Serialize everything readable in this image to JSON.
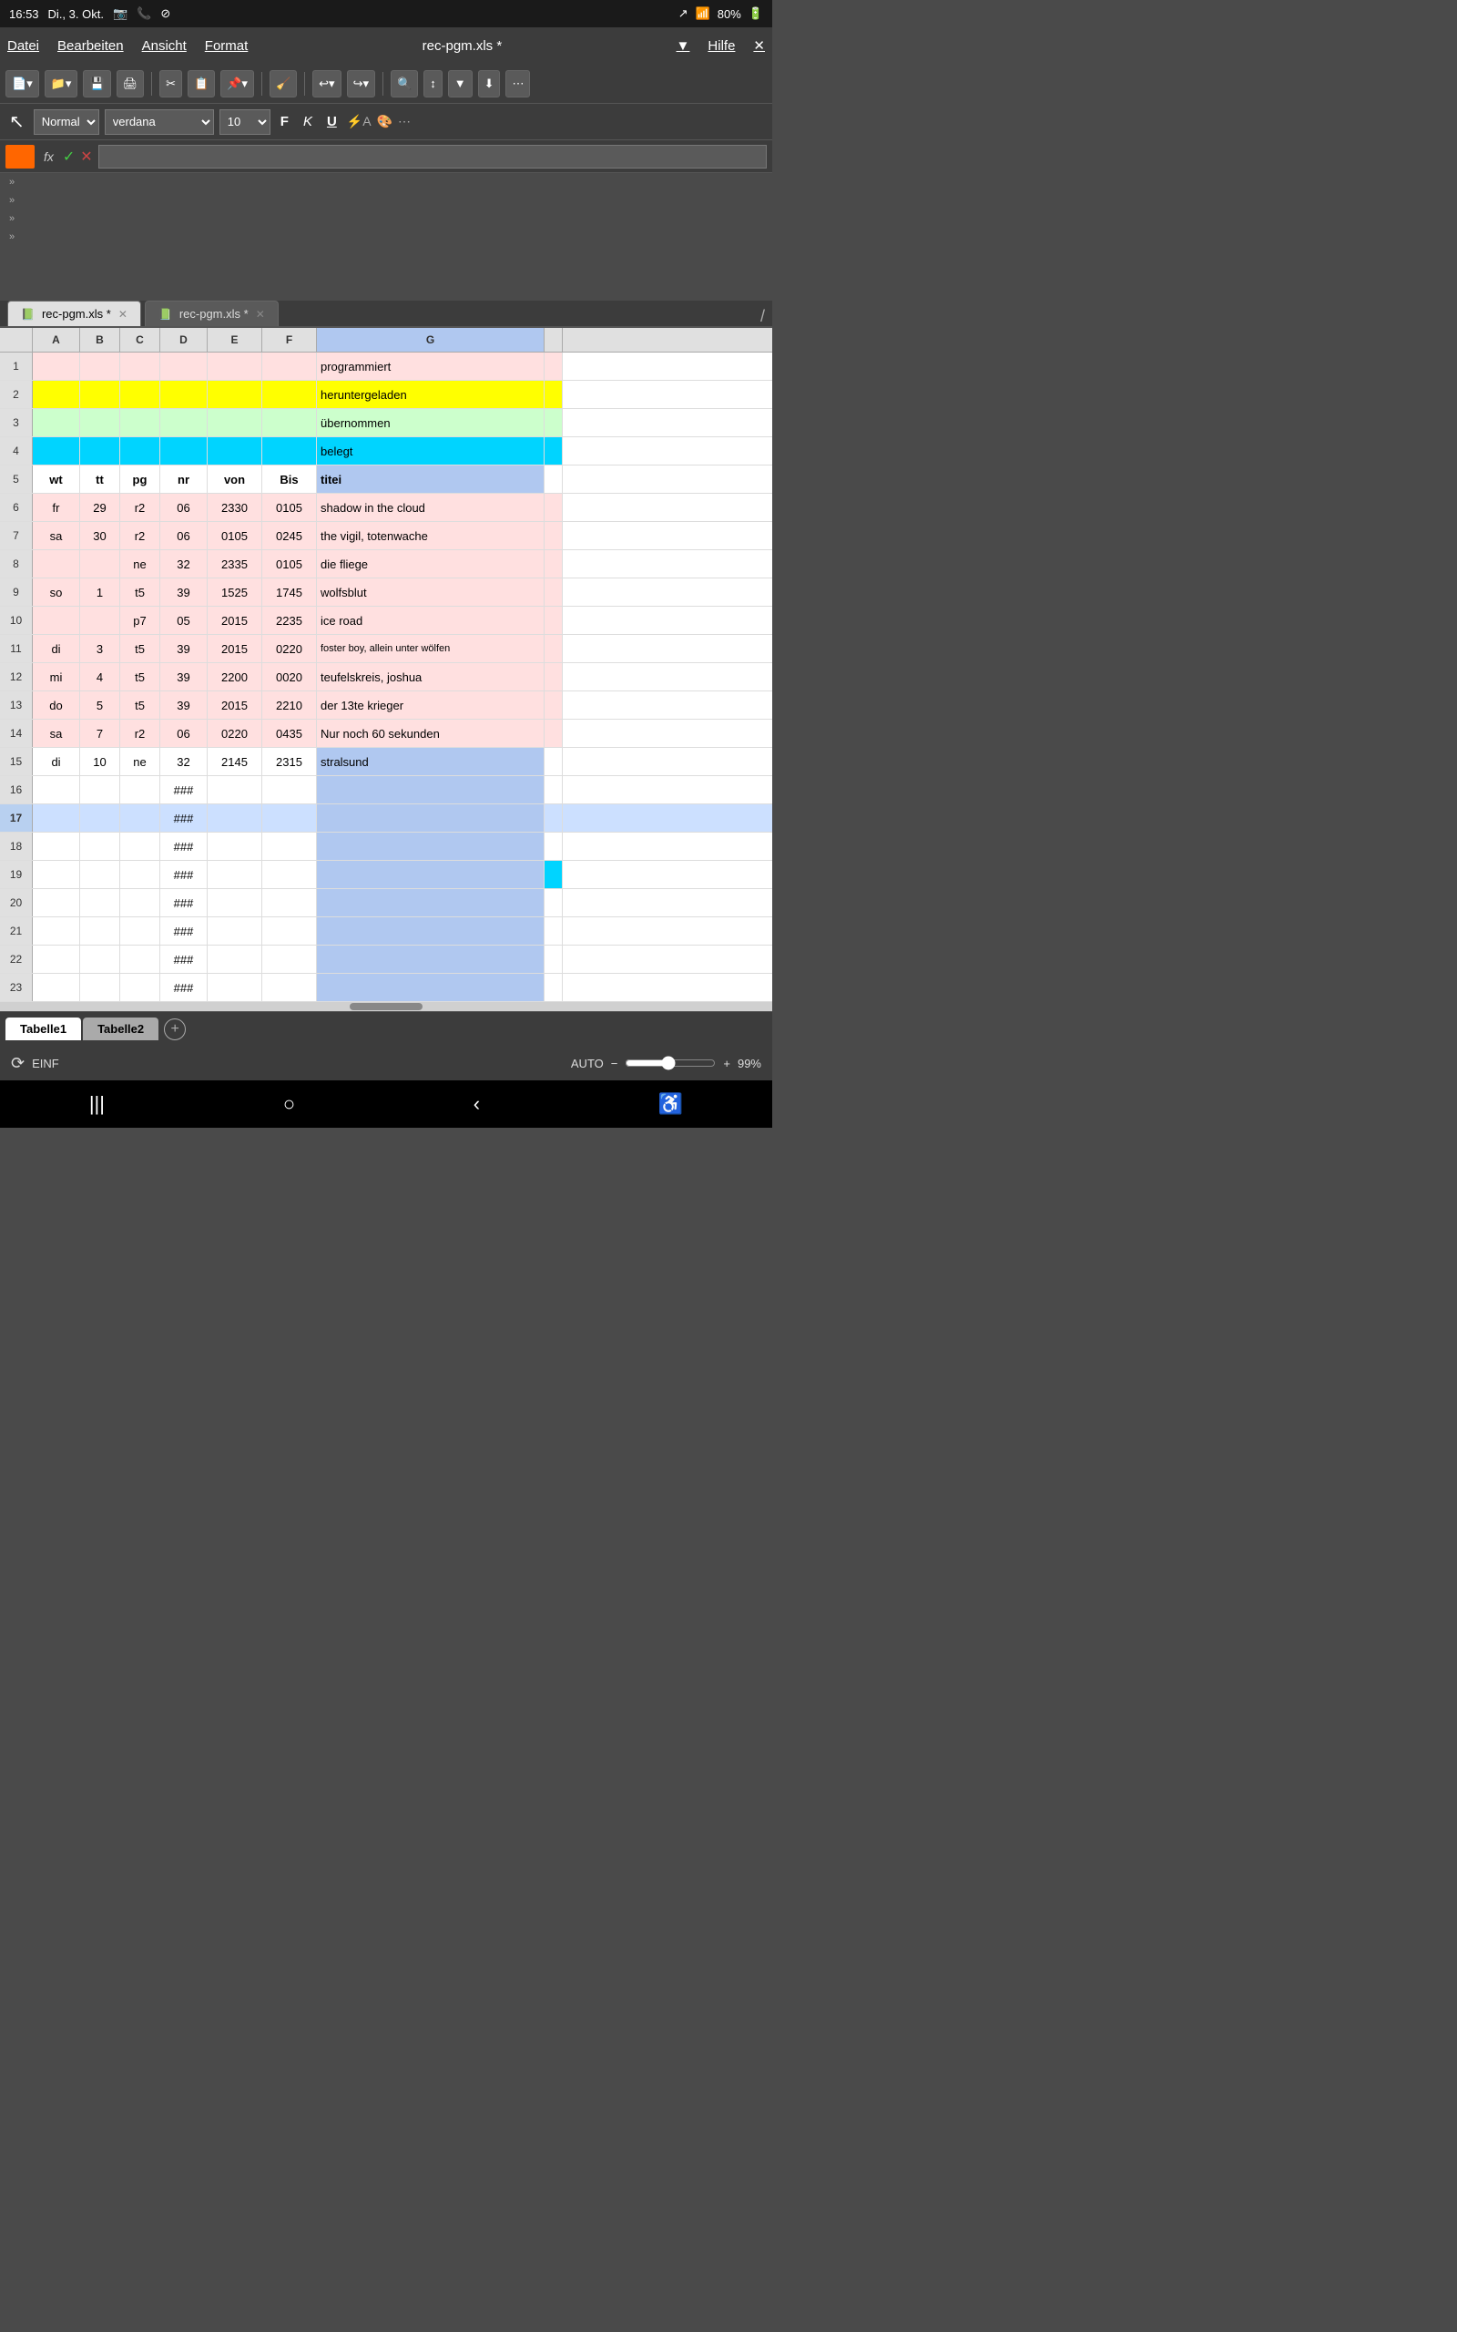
{
  "status_bar": {
    "time": "16:53",
    "date": "Di., 3. Okt.",
    "battery": "80%",
    "signal": "▲",
    "wifi": "WiFi"
  },
  "menu": {
    "items": [
      "Datei",
      "Bearbeiten",
      "Ansicht",
      "Format"
    ],
    "title": "rec-pgm.xls *",
    "hilfe": "Hilfe"
  },
  "toolbar": {
    "style_selector": "Normal",
    "font_selector": "verdana",
    "font_size": "10",
    "bold": "F",
    "italic": "K",
    "underline": "U"
  },
  "formula_bar": {
    "cell_ref": "",
    "fx": "fx",
    "check": "✓",
    "x": "✕",
    "formula": ""
  },
  "tabs": [
    {
      "label": "rec-pgm.xls *",
      "active": true
    },
    {
      "label": "rec-pgm.xls *",
      "active": false
    }
  ],
  "columns": [
    "A",
    "B",
    "C",
    "D",
    "E",
    "F",
    "G"
  ],
  "rows": [
    {
      "num": "1",
      "bg": "pink",
      "cells": [
        "",
        "",
        "",
        "",
        "",
        "",
        "programmiert"
      ]
    },
    {
      "num": "2",
      "bg": "yellow",
      "cells": [
        "",
        "",
        "",
        "",
        "",
        "",
        "heruntergeladen"
      ]
    },
    {
      "num": "3",
      "bg": "lightgreen",
      "cells": [
        "",
        "",
        "",
        "",
        "",
        "",
        "übernommen"
      ]
    },
    {
      "num": "4",
      "bg": "cyan",
      "cells": [
        "",
        "",
        "",
        "",
        "",
        "",
        "belegt"
      ]
    },
    {
      "num": "5",
      "bg": "white",
      "cells": [
        "wt",
        "tt",
        "pg",
        "nr",
        "von",
        "Bis",
        "titei"
      ],
      "bold": true
    },
    {
      "num": "6",
      "bg": "pink",
      "cells": [
        "fr",
        "29",
        "r2",
        "06",
        "2330",
        "0105",
        "shadow in the cloud"
      ]
    },
    {
      "num": "7",
      "bg": "pink",
      "cells": [
        "sa",
        "30",
        "r2",
        "06",
        "0105",
        "0245",
        "the vigil, totenwache"
      ]
    },
    {
      "num": "8",
      "bg": "pink",
      "cells": [
        "",
        "",
        "ne",
        "32",
        "2335",
        "0105",
        "die fliege"
      ]
    },
    {
      "num": "9",
      "bg": "pink",
      "cells": [
        "so",
        "1",
        "t5",
        "39",
        "1525",
        "1745",
        "wolfsblut"
      ]
    },
    {
      "num": "10",
      "bg": "pink",
      "cells": [
        "",
        "",
        "p7",
        "05",
        "2015",
        "2235",
        "ice road"
      ]
    },
    {
      "num": "11",
      "bg": "pink",
      "cells": [
        "di",
        "3",
        "t5",
        "39",
        "2015",
        "0220",
        "foster boy, allein unter wölfen"
      ]
    },
    {
      "num": "12",
      "bg": "pink",
      "cells": [
        "mi",
        "4",
        "t5",
        "39",
        "2200",
        "0020",
        "teufelskreis, joshua"
      ]
    },
    {
      "num": "13",
      "bg": "pink",
      "cells": [
        "do",
        "5",
        "t5",
        "39",
        "2015",
        "2210",
        "der 13te krieger"
      ]
    },
    {
      "num": "14",
      "bg": "pink",
      "cells": [
        "sa",
        "7",
        "r2",
        "06",
        "0220",
        "0435",
        "Nur noch 60 sekunden"
      ]
    },
    {
      "num": "15",
      "bg": "white",
      "cells": [
        "di",
        "10",
        "ne",
        "32",
        "2145",
        "2315",
        "stralsund"
      ]
    },
    {
      "num": "16",
      "bg": "white",
      "cells": [
        "",
        "",
        "",
        "###",
        "",
        "",
        ""
      ]
    },
    {
      "num": "17",
      "bg": "white",
      "cells": [
        "",
        "",
        "",
        "###",
        "",
        "",
        ""
      ],
      "bold_num": true
    },
    {
      "num": "18",
      "bg": "white",
      "cells": [
        "",
        "",
        "",
        "###",
        "",
        "",
        ""
      ]
    },
    {
      "num": "19",
      "bg": "white",
      "cells": [
        "",
        "",
        "",
        "###",
        "",
        "",
        ""
      ],
      "cyan_h": true
    },
    {
      "num": "20",
      "bg": "white",
      "cells": [
        "",
        "",
        "",
        "###",
        "",
        "",
        ""
      ]
    },
    {
      "num": "21",
      "bg": "white",
      "cells": [
        "",
        "",
        "",
        "###",
        "",
        "",
        ""
      ]
    },
    {
      "num": "22",
      "bg": "white",
      "cells": [
        "",
        "",
        "",
        "###",
        "",
        "",
        ""
      ]
    },
    {
      "num": "23",
      "bg": "white",
      "cells": [
        "",
        "",
        "",
        "###",
        "",
        "",
        ""
      ]
    }
  ],
  "sheet_tabs": [
    "Tabelle1",
    "Tabelle2"
  ],
  "active_sheet": "Tabelle1",
  "bottom_status": {
    "mode": "EINF",
    "auto": "AUTO",
    "zoom": "99%"
  },
  "android_nav": {
    "menu_icon": "|||",
    "home_icon": "○",
    "back_icon": "‹",
    "accessibility_icon": "♿"
  }
}
